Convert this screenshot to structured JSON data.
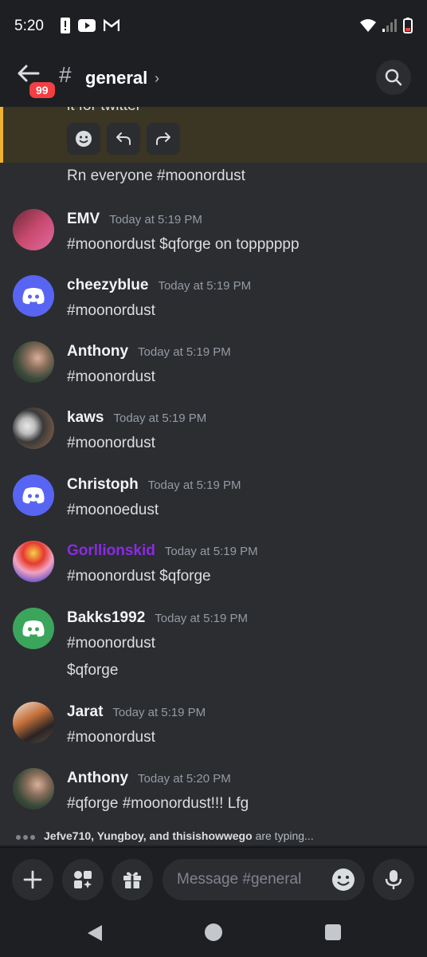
{
  "status_bar": {
    "time": "5:20"
  },
  "header": {
    "channel_name": "general",
    "badge_count": "99"
  },
  "highlighted": {
    "cut_text": "it for twitter"
  },
  "continuation_text": "Rn everyone #moonordust",
  "messages": [
    {
      "username": "EMV",
      "timestamp": "Today at 5:19 PM",
      "text": "#moonordust $qforge on topppppp",
      "text2": "",
      "avatar": "photo",
      "name_color": "#f2f3f5"
    },
    {
      "username": "cheezyblue",
      "timestamp": "Today at 5:19 PM",
      "text": "#moonordust",
      "text2": "",
      "avatar": "discord",
      "avatar_color": "#5865f2",
      "name_color": "#f2f3f5"
    },
    {
      "username": "Anthony",
      "timestamp": "Today at 5:19 PM",
      "text": "#moonordust",
      "text2": "",
      "avatar": "photo",
      "name_color": "#f2f3f5"
    },
    {
      "username": "kaws",
      "timestamp": "Today at 5:19 PM",
      "text": "#moonordust",
      "text2": "",
      "avatar": "photo",
      "name_color": "#f2f3f5"
    },
    {
      "username": "Christoph",
      "timestamp": "Today at 5:19 PM",
      "text": "#moonoedust",
      "text2": "",
      "avatar": "discord",
      "avatar_color": "#5865f2",
      "name_color": "#f2f3f5"
    },
    {
      "username": "Gorllionskid",
      "timestamp": "Today at 5:19 PM",
      "text": "#moonordust $qforge",
      "text2": "",
      "avatar": "photo",
      "name_color": "#8a2be2"
    },
    {
      "username": "Bakks1992",
      "timestamp": "Today at 5:19 PM",
      "text": "#moonordust",
      "text2": "$qforge",
      "avatar": "discord",
      "avatar_color": "#3ba55c",
      "name_color": "#f2f3f5"
    },
    {
      "username": "Jarat",
      "timestamp": "Today at 5:19 PM",
      "text": "#moonordust",
      "text2": "",
      "avatar": "photo",
      "name_color": "#f2f3f5"
    },
    {
      "username": "Anthony",
      "timestamp": "Today at 5:20 PM",
      "text": "#qforge #moonordust!!! Lfg",
      "text2": "",
      "avatar": "photo",
      "name_color": "#f2f3f5"
    }
  ],
  "typing": {
    "names": "Jefve710, Yungboy, and thisishowwego",
    "suffix": "are typing..."
  },
  "composer": {
    "placeholder": "Message #general"
  }
}
